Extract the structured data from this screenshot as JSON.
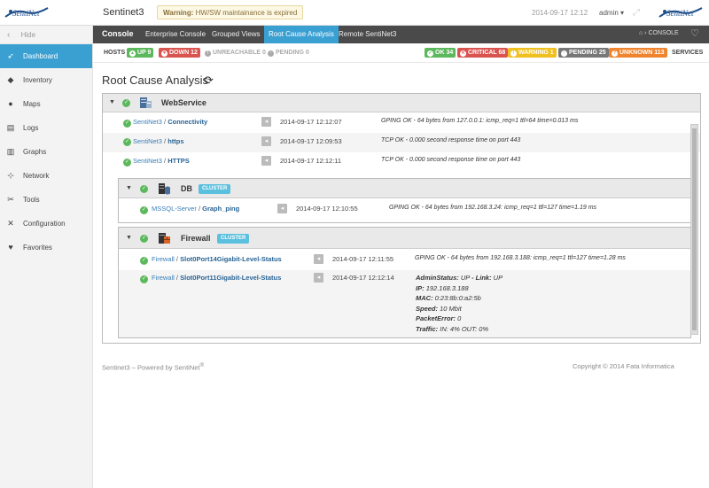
{
  "header": {
    "logo_text": "SentiNet",
    "app_title": "Sentinet3",
    "warning_label": "Warning:",
    "warning_text": "HW/SW maintainance is expired",
    "datetime": "2014-09-17 12:12",
    "user": "admin"
  },
  "sidebar": {
    "hide_label": "Hide",
    "items": [
      {
        "label": "Dashboard",
        "icon": "rocket-icon",
        "active": true
      },
      {
        "label": "Inventory",
        "icon": "tag-icon"
      },
      {
        "label": "Maps",
        "icon": "globe-icon"
      },
      {
        "label": "Logs",
        "icon": "book-icon"
      },
      {
        "label": "Graphs",
        "icon": "bar-chart-icon"
      },
      {
        "label": "Network",
        "icon": "network-icon"
      },
      {
        "label": "Tools",
        "icon": "wrench-icon"
      },
      {
        "label": "Configuration",
        "icon": "settings-icon"
      },
      {
        "label": "Favorites",
        "icon": "heart-icon"
      }
    ]
  },
  "console_bar": {
    "title": "Console",
    "tabs": [
      "Enterprise Console",
      "Grouped Views",
      "Root Cause Analysis",
      "Remote SentiNet3"
    ],
    "active_tab": "Root Cause Analysis",
    "home_label": "CONSOLE"
  },
  "status": {
    "hosts_label": "HOSTS",
    "services_label": "SERVICES",
    "hosts": {
      "up": "UP 9",
      "down": "DOWN 12",
      "unreachable": "UNREACHABLE 0",
      "pending": "PENDING 0"
    },
    "services": {
      "ok": "OK 34",
      "critical": "CRITICAL 68",
      "warning": "WARNING 1",
      "pending": "PENDING 25",
      "unknown": "UNKNOWN 113"
    }
  },
  "colors": {
    "accent": "#3aa0d2",
    "ok": "#5cb85c",
    "critical": "#d9534f",
    "warning": "#f0c020",
    "pending": "#777777",
    "unknown": "#f0852f",
    "cluster": "#5bc0de"
  },
  "page": {
    "title": "Root Cause Analysis"
  },
  "webservice": {
    "name": "WebService",
    "rows": [
      {
        "host": "SentiNet3",
        "service": "Connectivity",
        "time": "2014-09-17 12:12:07",
        "output": "GPING OK - 64 bytes from 127.0.0.1: icmp_req=1 ttl=64 time=0.013 ms"
      },
      {
        "host": "SentiNet3",
        "service": "https",
        "time": "2014-09-17 12:09:53",
        "output": "TCP OK - 0.000 second response time on port 443"
      },
      {
        "host": "SentiNet3",
        "service": "HTTPS",
        "time": "2014-09-17 12:12:11",
        "output": "TCP OK - 0.000 second response time on port 443"
      }
    ]
  },
  "db": {
    "name": "DB",
    "badge": "CLUSTER",
    "rows": [
      {
        "host": "MSSQL-Server",
        "service": "Graph_ping",
        "time": "2014-09-17 12:10:55",
        "output": "GPING OK - 64 bytes from 192.168.3.24: icmp_req=1 ttl=127 time=1.19 ms"
      }
    ]
  },
  "firewall": {
    "name": "Firewall",
    "badge": "CLUSTER",
    "rows": [
      {
        "host": "Firewall",
        "service": "Slot0Port14Gigabit-Level-Status",
        "time": "2014-09-17 12:11:55",
        "output": "GPING OK - 64 bytes from 192.168.3.188: icmp_req=1 ttl=127 time=1.28 ms"
      },
      {
        "host": "Firewall",
        "service": "Slot0Port11Gigabit-Level-Status",
        "time": "2014-09-17 12:12:14"
      }
    ],
    "detail": {
      "admin_status_label": "AdminStatus:",
      "admin_status": "UP",
      "link_label": "- Link:",
      "link": "UP",
      "ip_label": "IP:",
      "ip": "192.168.3.188",
      "mac_label": "MAC:",
      "mac": "0:23:8b:0:a2:5b",
      "speed_label": "Speed:",
      "speed": "10 Mbit",
      "packet_error_label": "PacketError:",
      "packet_error": "0",
      "traffic_label": "Traffic:",
      "traffic": "IN: 4% OUT: 0%"
    }
  },
  "footer": {
    "left": "Sentinet3 – Powered by SentiNet",
    "left_suffix": "®",
    "right": "Copyright © 2014 Fata Informatica"
  }
}
